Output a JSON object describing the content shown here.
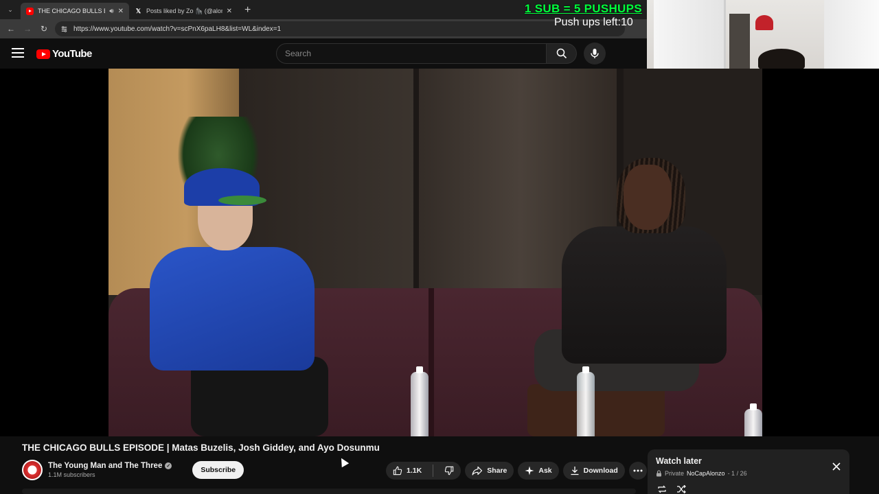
{
  "browser": {
    "tabs": [
      {
        "title": "THE CHICAGO BULLS EPISODE",
        "icon": "youtube-favicon",
        "active": true
      },
      {
        "title": "Posts liked by Zo 🦍 (@alonzo",
        "icon": "x-favicon",
        "active": false
      }
    ],
    "url": "https://www.youtube.com/watch?v=scPnX6paLH8&list=WL&index=1"
  },
  "overlay": {
    "sub_text": "1 SUB = 5 PUSHUPS",
    "pushups_text": "Push ups left:10",
    "sub_color": "#00ff3c"
  },
  "youtube": {
    "logo_text": "YouTube",
    "search_placeholder": "Search"
  },
  "video": {
    "title": "THE CHICAGO BULLS EPISODE | Matas Buzelis, Josh Giddey, and Ayo Dosunmu",
    "channel_name": "The Young Man and The Three",
    "subscribers": "1.1M subscribers",
    "subscribe_label": "Subscribe",
    "like_count": "1.1K",
    "share_label": "Share",
    "ask_label": "Ask",
    "download_label": "Download"
  },
  "playlist": {
    "title": "Watch later",
    "privacy": "Private",
    "owner": "NoCapAlonzo",
    "position": "- 1 / 26"
  }
}
